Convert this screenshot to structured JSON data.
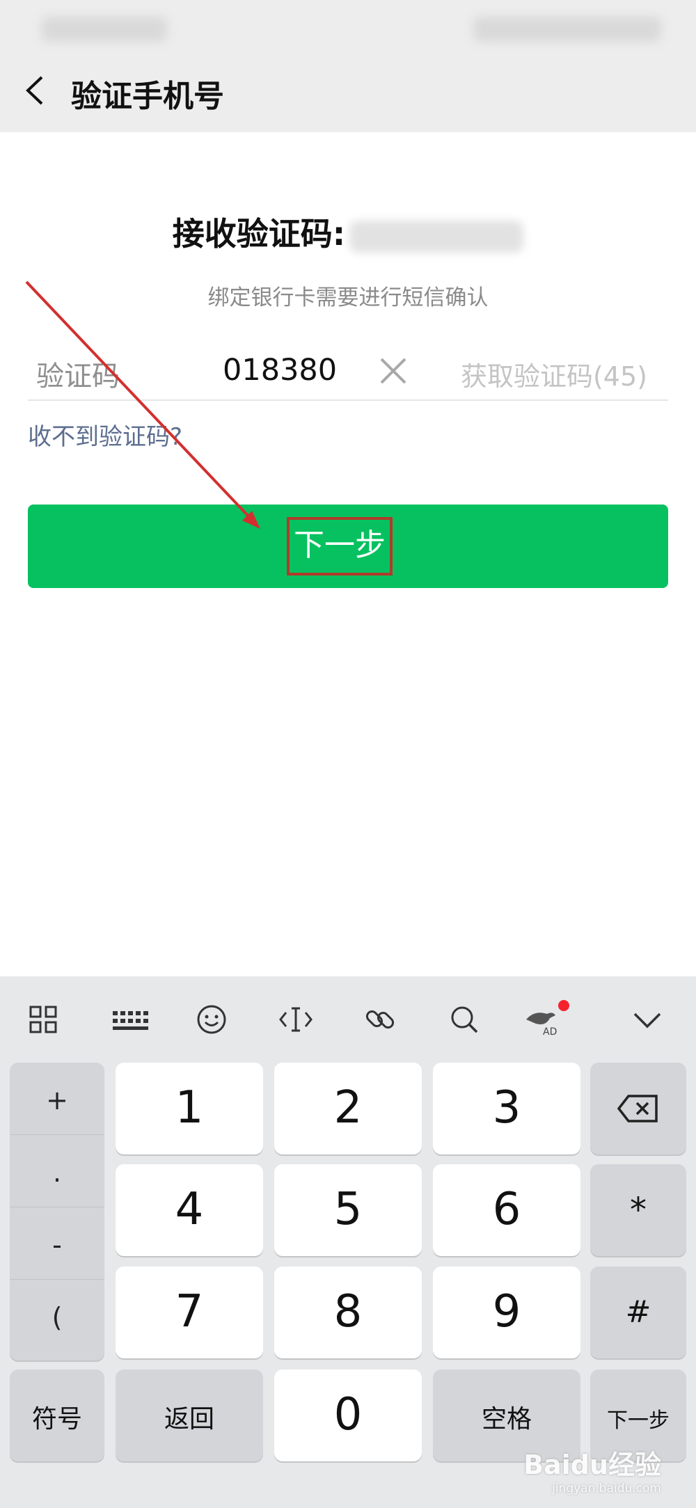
{
  "header": {
    "title": "验证手机号"
  },
  "content": {
    "receive_label": "接收验证码:",
    "hint": "绑定银行卡需要进行短信确认",
    "code_label": "验证码",
    "code_value": "018380",
    "get_code": "获取验证码(45)",
    "no_code_link": "收不到验证码?",
    "next_button": "下一步"
  },
  "keyboard": {
    "symbols": [
      "+",
      ".",
      "-",
      "("
    ],
    "digits": [
      "1",
      "2",
      "3",
      "4",
      "5",
      "6",
      "7",
      "8",
      "9",
      "0"
    ],
    "side_keys": [
      "*",
      "#"
    ],
    "bottom": {
      "symbol": "符号",
      "back": "返回",
      "space": "空格",
      "next": "下一步"
    },
    "toolbar_ad": "AD"
  },
  "watermark": {
    "brand": "Baidu经验",
    "url": "jingyan.baidu.com"
  },
  "colors": {
    "accent": "#07c160",
    "link": "#5d6e90",
    "highlight": "#b13a2a",
    "arrow": "#d32f2f",
    "badge": "#f5222d"
  }
}
